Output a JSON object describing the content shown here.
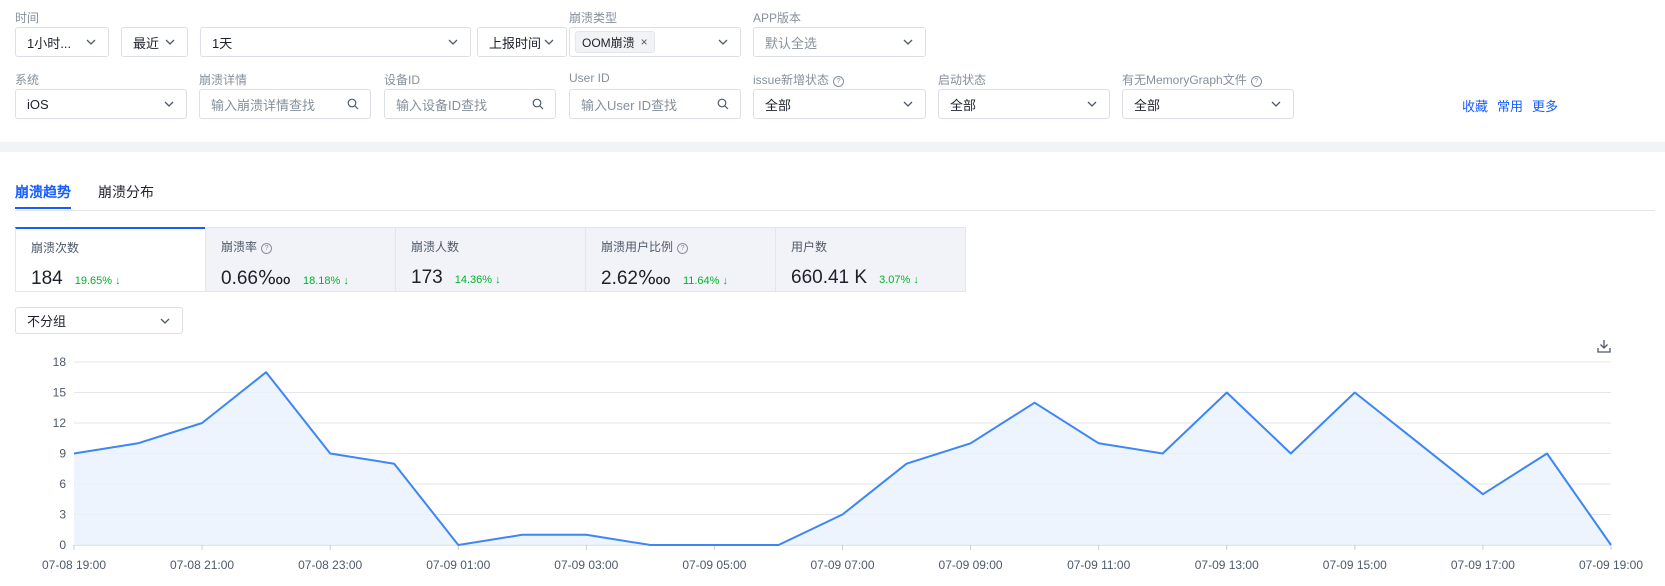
{
  "filters": {
    "row1": {
      "time": {
        "label": "时间",
        "value": "1小时...",
        "range_value": "最近",
        "period_value": "1天",
        "report_value": "上报时间"
      },
      "crash_type": {
        "label": "崩溃类型",
        "tag": "OOM崩溃",
        "tag_close": "×"
      },
      "app_version": {
        "label": "APP版本",
        "placeholder": "默认全选"
      }
    },
    "row2": {
      "system": {
        "label": "系统",
        "value": "iOS"
      },
      "crash_detail": {
        "label": "崩溃详情",
        "placeholder": "输入崩溃详情查找"
      },
      "device_id": {
        "label": "设备ID",
        "placeholder": "输入设备ID查找"
      },
      "user_id": {
        "label": "User ID",
        "placeholder": "输入User ID查找"
      },
      "issue_status": {
        "label": "issue新增状态",
        "value": "全部"
      },
      "launch_status": {
        "label": "启动状态",
        "value": "全部"
      },
      "memory_graph": {
        "label": "有无MemoryGraph文件",
        "value": "全部"
      }
    },
    "actions": {
      "favorite": "收藏",
      "common": "常用",
      "more": "更多"
    }
  },
  "tabs": [
    {
      "label": "崩溃趋势",
      "active": true
    },
    {
      "label": "崩溃分布",
      "active": false
    }
  ],
  "metrics": [
    {
      "title": "崩溃次数",
      "value": "184",
      "change": "19.65%",
      "help": false
    },
    {
      "title": "崩溃率",
      "value": "0.66‱",
      "change": "18.18%",
      "help": true
    },
    {
      "title": "崩溃人数",
      "value": "173",
      "change": "14.36%",
      "help": false
    },
    {
      "title": "崩溃用户比例",
      "value": "2.62‱",
      "change": "11.64%",
      "help": true
    },
    {
      "title": "用户数",
      "value": "660.41 K",
      "change": "3.07%",
      "help": false
    }
  ],
  "group_select": {
    "value": "不分组"
  },
  "icons": {
    "download": "download-icon",
    "chevron": "chevron-down-icon",
    "search": "search-icon",
    "help": "question-circle-icon",
    "down_arrow": "arrow-down-icon"
  },
  "colors": {
    "accent": "#165dff",
    "line": "#3c86f5",
    "decrease": "#00b42a"
  },
  "chart_data": {
    "type": "area",
    "x": [
      "07-08 19:00",
      "07-08 20:00",
      "07-08 21:00",
      "07-08 22:00",
      "07-08 23:00",
      "07-09 00:00",
      "07-09 01:00",
      "07-09 02:00",
      "07-09 03:00",
      "07-09 04:00",
      "07-09 05:00",
      "07-09 06:00",
      "07-09 07:00",
      "07-09 08:00",
      "07-09 09:00",
      "07-09 10:00",
      "07-09 11:00",
      "07-09 12:00",
      "07-09 13:00",
      "07-09 14:00",
      "07-09 15:00",
      "07-09 16:00",
      "07-09 17:00",
      "07-09 18:00",
      "07-09 19:00"
    ],
    "x_tick_labels": [
      "07-08 19:00",
      "07-08 21:00",
      "07-08 23:00",
      "07-09 01:00",
      "07-09 03:00",
      "07-09 05:00",
      "07-09 07:00",
      "07-09 09:00",
      "07-09 11:00",
      "07-09 13:00",
      "07-09 15:00",
      "07-09 17:00",
      "07-09 19:00"
    ],
    "series": [
      {
        "values": [
          9,
          10,
          12,
          17,
          9,
          8,
          0,
          1,
          1,
          0,
          0,
          0,
          3,
          8,
          10,
          14,
          10,
          9,
          15,
          9,
          15,
          10,
          5,
          9,
          0
        ]
      }
    ],
    "yticks": [
      0,
      3,
      6,
      9,
      12,
      15,
      18
    ],
    "ylim": [
      0,
      18
    ],
    "grid": true,
    "legend": "none"
  }
}
